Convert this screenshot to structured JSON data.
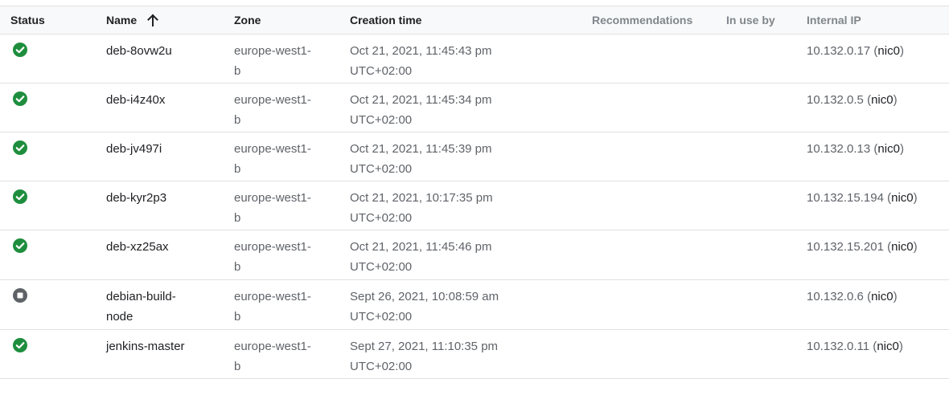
{
  "header": {
    "status": "Status",
    "name": "Name",
    "zone": "Zone",
    "creation_time": "Creation time",
    "recommendations": "Recommendations",
    "in_use_by": "In use by",
    "internal_ip": "Internal IP"
  },
  "rows": [
    {
      "status": "running",
      "name_1": "deb-8ovw2u",
      "name_2": "",
      "zone_1": "europe-west1-",
      "zone_2": "b",
      "time_1": "Oct 21, 2021, 11:45:43 pm",
      "time_2": "UTC+02:00",
      "ip": "10.132.0.17",
      "nic": "nic0"
    },
    {
      "status": "running",
      "name_1": "deb-i4z40x",
      "name_2": "",
      "zone_1": "europe-west1-",
      "zone_2": "b",
      "time_1": "Oct 21, 2021, 11:45:34 pm",
      "time_2": "UTC+02:00",
      "ip": "10.132.0.5",
      "nic": "nic0"
    },
    {
      "status": "running",
      "name_1": "deb-jv497i",
      "name_2": "",
      "zone_1": "europe-west1-",
      "zone_2": "b",
      "time_1": "Oct 21, 2021, 11:45:39 pm",
      "time_2": "UTC+02:00",
      "ip": "10.132.0.13",
      "nic": "nic0"
    },
    {
      "status": "running",
      "name_1": "deb-kyr2p3",
      "name_2": "",
      "zone_1": "europe-west1-",
      "zone_2": "b",
      "time_1": "Oct 21, 2021, 10:17:35 pm",
      "time_2": "UTC+02:00",
      "ip": "10.132.15.194",
      "nic": "nic0"
    },
    {
      "status": "running",
      "name_1": "deb-xz25ax",
      "name_2": "",
      "zone_1": "europe-west1-",
      "zone_2": "b",
      "time_1": "Oct 21, 2021, 11:45:46 pm",
      "time_2": "UTC+02:00",
      "ip": "10.132.15.201",
      "nic": "nic0"
    },
    {
      "status": "stopped",
      "name_1": "debian-build-",
      "name_2": "node",
      "zone_1": "europe-west1-",
      "zone_2": "b",
      "time_1": "Sept 26, 2021, 10:08:59 am",
      "time_2": "UTC+02:00",
      "ip": "10.132.0.6",
      "nic": "nic0"
    },
    {
      "status": "running",
      "name_1": "jenkins-master",
      "name_2": "",
      "zone_1": "europe-west1-",
      "zone_2": "b",
      "time_1": "Sept 27, 2021, 11:10:35 pm",
      "time_2": "UTC+02:00",
      "ip": "10.132.0.11",
      "nic": "nic0"
    }
  ],
  "colors": {
    "running": "#1e8e3e",
    "stopped": "#5f6368"
  },
  "icons": {
    "running": "check-circle-icon",
    "stopped": "stop-circle-icon",
    "sort": "arrow-up-icon"
  }
}
